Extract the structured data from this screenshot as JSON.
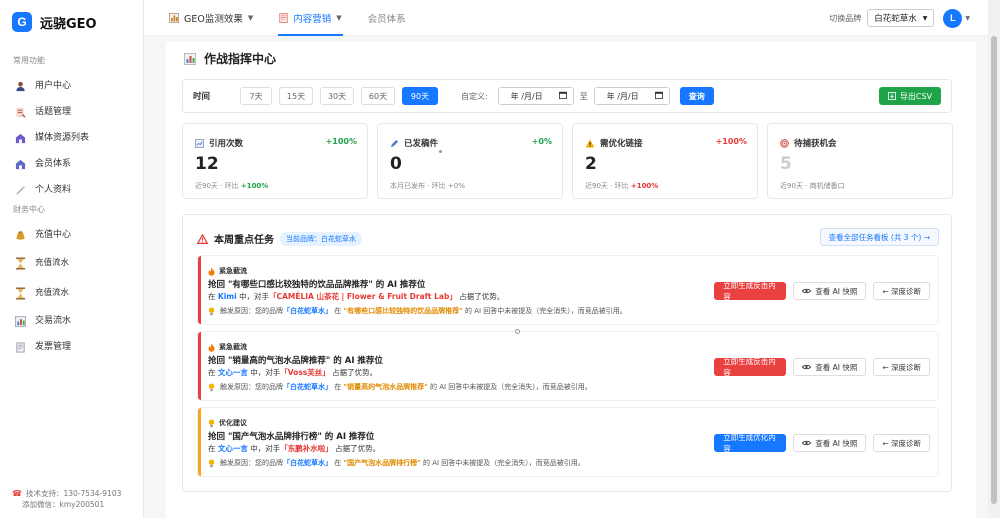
{
  "app": {
    "logo_letter": "G",
    "name": "远骁GEO"
  },
  "sidebar": {
    "sections": [
      {
        "label": "常用功能",
        "items": [
          {
            "label": "用户中心",
            "icon": "user-icon"
          },
          {
            "label": "话题管理",
            "icon": "topic-icon"
          },
          {
            "label": "媒体资源列表",
            "icon": "media-icon"
          },
          {
            "label": "会员体系",
            "icon": "member-icon"
          },
          {
            "label": "个人资料",
            "icon": "profile-icon"
          }
        ]
      },
      {
        "label": "财务中心",
        "items": [
          {
            "label": "充值中心",
            "icon": "wallet-icon"
          },
          {
            "label": "充值流水",
            "icon": "hourglass-icon"
          },
          {
            "label": "充值流水",
            "icon": "hourglass-icon"
          },
          {
            "label": "交易流水",
            "icon": "chart-icon"
          },
          {
            "label": "发票管理",
            "icon": "invoice-icon"
          }
        ]
      }
    ],
    "footer": {
      "support": "技术支持：130-7534-9103",
      "wechat": "添加微信：kmy200501"
    }
  },
  "topbar": {
    "tabs": [
      {
        "label": "GEO监测效果",
        "icon": "monitor-icon",
        "has_dropdown": true
      },
      {
        "label": "内容营销",
        "icon": "document-icon",
        "has_dropdown": true
      },
      {
        "label": "会员体系",
        "icon": "",
        "has_dropdown": false
      }
    ],
    "brand_label": "切换品牌",
    "brand_value": "白花蛇草水",
    "avatar_letter": "L"
  },
  "page": {
    "title": "作战指挥中心"
  },
  "filter": {
    "time_label": "时间",
    "ranges": [
      "7天",
      "15天",
      "30天",
      "60天",
      "90天"
    ],
    "active_range": "90天",
    "custom_label": "自定义:",
    "date_placeholder": "年 /月/日",
    "to_label": "至",
    "query_label": "查询",
    "export_label": "导出CSV"
  },
  "stats": [
    {
      "title": "引用次数",
      "icon": "chart-bar-icon",
      "change": "+100%",
      "change_color": "#1fa34a",
      "value": "12",
      "sub_prefix": "近90天 · 环比",
      "sub_change": "+100%",
      "sub_color": "#1fa34a"
    },
    {
      "title": "已发稿件",
      "icon": "pencil-icon",
      "change": "+0%",
      "change_color": "#1fa34a",
      "value": "0",
      "sub_prefix": "本月已发布 · 环比",
      "sub_change": "+0%",
      "sub_color": "#888888"
    },
    {
      "title": "需优化链接",
      "icon": "warning-icon",
      "change": "+100%",
      "change_color": "#e53935",
      "value": "2",
      "sub_prefix": "近90天 · 环比",
      "sub_change": "+100%",
      "sub_color": "#e53935"
    },
    {
      "title": "待捕获机会",
      "icon": "target-icon",
      "change": "",
      "change_color": "#888888",
      "value": "5",
      "sub_prefix": "近90天 · 商机储备口",
      "sub_change": "",
      "sub_color": "#888888"
    }
  ],
  "tasks_panel": {
    "title": "本周重点任务",
    "brand_badge": "当前品牌：白花蛇草水",
    "view_all": "查看全部任务看板 (共 3 个) →",
    "tasks": [
      {
        "tag": "紧急截流",
        "type": "urgent",
        "stripe_color": "#e94040",
        "title": "抢回 \"有哪些口感比较独特的饮品品牌推荐\" 的 AI 推荐位",
        "line_in": "在",
        "model": "Kimi",
        "line_mid": "中，对手",
        "competitor": "「CAMÉLIA 山茶花 | Flower & Fruit Draft Lab」",
        "line_end": "占据了优势。",
        "reason_prefix": "触发原因：您的品牌",
        "brand": "「白花蛇草水」",
        "reason_in": "在",
        "query": "\"有哪些口感比较独特的饮品品牌推荐\"",
        "reason_end": "的 AI 回答中未被提及（完全消失），而竞品被引用。",
        "primary_action": "立即生成反击内容"
      },
      {
        "tag": "紧急截流",
        "type": "urgent",
        "stripe_color": "#e94040",
        "title": "抢回 \"销量高的气泡水品牌推荐\" 的 AI 推荐位",
        "line_in": "在",
        "model": "文心一言",
        "line_mid": "中，对手",
        "competitor": "「Voss芙丝」",
        "line_end": "占据了优势。",
        "reason_prefix": "触发原因：您的品牌",
        "brand": "「白花蛇草水」",
        "reason_in": "在",
        "query": "\"销量高的气泡水品牌推荐\"",
        "reason_end": "的 AI 回答中未被提及（完全消失），而竞品被引用。",
        "primary_action": "立即生成反击内容"
      },
      {
        "tag": "优化建议",
        "type": "optimize",
        "stripe_color": "#f5a623",
        "title": "抢回 \"国产气泡水品牌排行榜\" 的 AI 推荐位",
        "line_in": "在",
        "model": "文心一言",
        "line_mid": "中，对手",
        "competitor": "「东鹏补水啦」",
        "line_end": "占据了优势。",
        "reason_prefix": "触发原因：您的品牌",
        "brand": "「白花蛇草水」",
        "reason_in": "在",
        "query": "\"国产气泡水品牌排行榜\"",
        "reason_end": "的 AI 回答中未被提及（完全消失），而竞品被引用。",
        "primary_action": "立即生成优化内容"
      }
    ],
    "snapshot_label": "查看 AI 快照",
    "diagnose_label": "← 深度诊断"
  },
  "colors": {
    "accent": "#1677ff",
    "danger": "#e94040",
    "success": "#1fa34a",
    "warning": "#f5a623"
  }
}
